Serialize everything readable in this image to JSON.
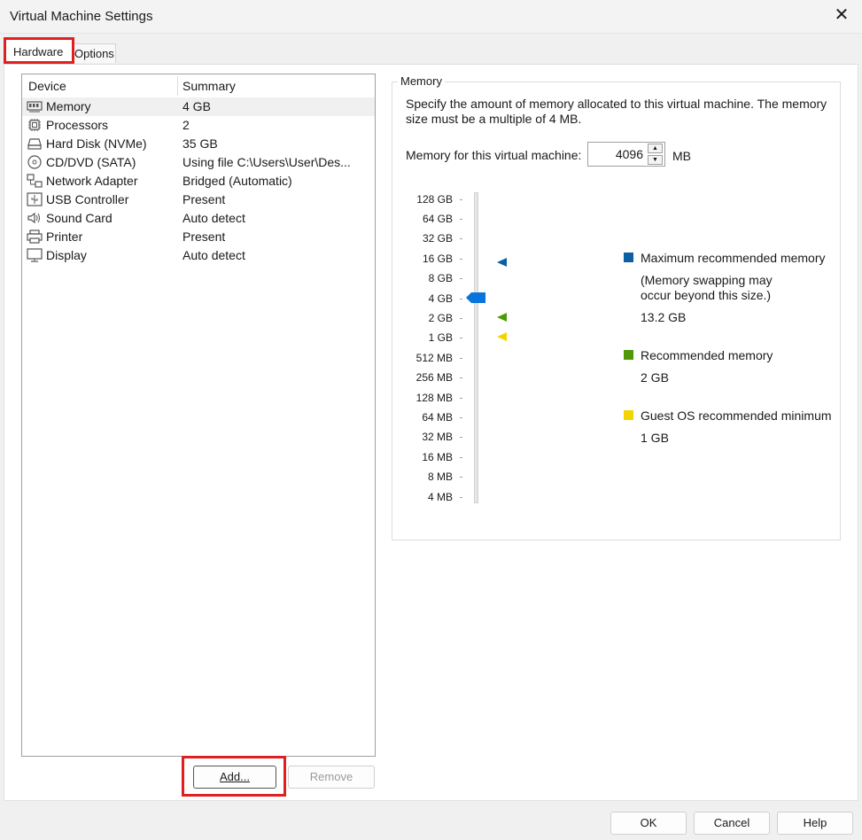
{
  "window": {
    "title": "Virtual Machine Settings",
    "close_glyph": "✕"
  },
  "tabs": {
    "hardware": "Hardware",
    "options": "Options"
  },
  "device_list": {
    "headers": {
      "device": "Device",
      "summary": "Summary"
    },
    "rows": [
      {
        "icon": "memory-icon",
        "device": "Memory",
        "summary": "4 GB"
      },
      {
        "icon": "processor-icon",
        "device": "Processors",
        "summary": "2"
      },
      {
        "icon": "hard-disk-icon",
        "device": "Hard Disk (NVMe)",
        "summary": "35 GB"
      },
      {
        "icon": "cd-dvd-icon",
        "device": "CD/DVD (SATA)",
        "summary": "Using file C:\\Users\\User\\Des..."
      },
      {
        "icon": "network-adapter-icon",
        "device": "Network Adapter",
        "summary": "Bridged (Automatic)"
      },
      {
        "icon": "usb-icon",
        "device": "USB Controller",
        "summary": "Present"
      },
      {
        "icon": "sound-icon",
        "device": "Sound Card",
        "summary": "Auto detect"
      },
      {
        "icon": "printer-icon",
        "device": "Printer",
        "summary": "Present"
      },
      {
        "icon": "display-icon",
        "device": "Display",
        "summary": "Auto detect"
      }
    ],
    "selected_index": 0
  },
  "buttons": {
    "add": "Add...",
    "remove": "Remove",
    "ok": "OK",
    "cancel": "Cancel",
    "help": "Help"
  },
  "memory": {
    "group_title": "Memory",
    "description": "Specify the amount of memory allocated to this virtual machine. The memory size must be a multiple of 4 MB.",
    "label": "Memory for this virtual machine:",
    "value": "4096",
    "unit": "MB",
    "scale": [
      "128 GB",
      "64 GB",
      "32 GB",
      "16 GB",
      "8 GB",
      "4 GB",
      "2 GB",
      "1 GB",
      "512 MB",
      "256 MB",
      "128 MB",
      "64 MB",
      "32 MB",
      "16 MB",
      "8 MB",
      "4 MB"
    ],
    "legend": {
      "max": {
        "title": "Maximum recommended memory",
        "note_line1": "(Memory swapping may",
        "note_line2": "occur beyond this size.)",
        "value": "13.2 GB",
        "color": "#0b5fa5"
      },
      "recommended": {
        "title": "Recommended memory",
        "value": "2 GB",
        "color": "#4e9a06"
      },
      "minimum": {
        "title": "Guest OS recommended minimum",
        "value": "1 GB",
        "color": "#f2d500"
      }
    },
    "thumb_color": "#0a74da"
  }
}
